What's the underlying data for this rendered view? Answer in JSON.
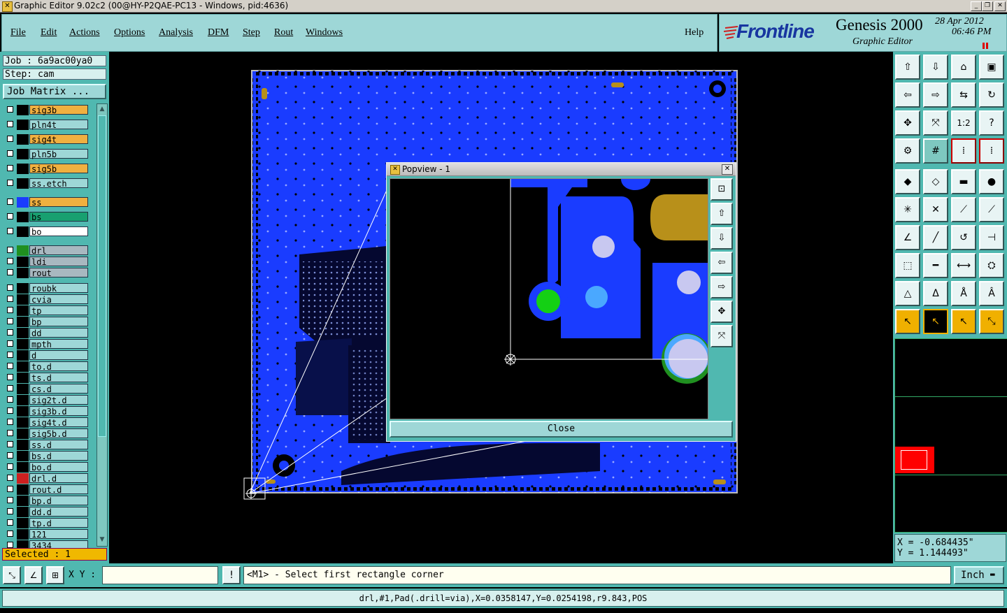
{
  "window": {
    "title": "Graphic Editor 9.02c2 (00@HY-P2QAE-PC13 - Windows, pid:4636)"
  },
  "menu": {
    "items": [
      "File",
      "Edit",
      "Actions",
      "Options",
      "Analysis",
      "DFM",
      "Step",
      "Rout",
      "Windows"
    ],
    "help": "Help"
  },
  "brand": {
    "logo": "Frontline",
    "product": "Genesis 2000",
    "subtitle": "Graphic Editor",
    "date": "28 Apr 2012",
    "time": "06:46 PM"
  },
  "job": {
    "job_label": "Job : 6a9ac00ya0",
    "step_label": "Step: cam",
    "matrix_button": "Job Matrix ..."
  },
  "layers": [
    {
      "name": "sig3b",
      "bg": "#f0b040",
      "color": "#000000"
    },
    {
      "name": "pln4t",
      "bg": "#9ed7d7",
      "color": "#000000"
    },
    {
      "name": "sig4t",
      "bg": "#f0b040",
      "color": "#000000"
    },
    {
      "name": "pln5b",
      "bg": "#9ed7d7",
      "color": "#000000"
    },
    {
      "name": "sig5b",
      "bg": "#f0b040",
      "color": "#000000"
    },
    {
      "name": "ss.etch",
      "bg": "#9ed7d7",
      "color": "#000000"
    },
    {
      "name": "ss",
      "bg": "#f0b040",
      "color": "#1a3cff"
    },
    {
      "name": "bs",
      "bg": "#18a070",
      "color": "#000000"
    },
    {
      "name": "bo",
      "bg": "#ffffff",
      "color": "#000000"
    },
    {
      "name": "drl",
      "bg": "#a8b8c0",
      "color": "#209020"
    },
    {
      "name": "ldi",
      "bg": "#a8b8c0",
      "color": "#000000"
    },
    {
      "name": "rout",
      "bg": "#a8b8c0",
      "color": "#000000"
    },
    {
      "name": "roubk",
      "bg": "#9ed7d7",
      "color": "#000000"
    },
    {
      "name": "cvia",
      "bg": "#9ed7d7",
      "color": "#000000"
    },
    {
      "name": "tp",
      "bg": "#9ed7d7",
      "color": "#000000"
    },
    {
      "name": "bp",
      "bg": "#9ed7d7",
      "color": "#000000"
    },
    {
      "name": "dd",
      "bg": "#9ed7d7",
      "color": "#000000"
    },
    {
      "name": "mpth",
      "bg": "#9ed7d7",
      "color": "#000000"
    },
    {
      "name": "d",
      "bg": "#9ed7d7",
      "color": "#000000"
    },
    {
      "name": "to.d",
      "bg": "#9ed7d7",
      "color": "#000000"
    },
    {
      "name": "ts.d",
      "bg": "#9ed7d7",
      "color": "#000000"
    },
    {
      "name": "cs.d",
      "bg": "#9ed7d7",
      "color": "#000000"
    },
    {
      "name": "sig2t.d",
      "bg": "#9ed7d7",
      "color": "#000000"
    },
    {
      "name": "sig3b.d",
      "bg": "#9ed7d7",
      "color": "#000000"
    },
    {
      "name": "sig4t.d",
      "bg": "#9ed7d7",
      "color": "#000000"
    },
    {
      "name": "sig5b.d",
      "bg": "#9ed7d7",
      "color": "#000000"
    },
    {
      "name": "ss.d",
      "bg": "#9ed7d7",
      "color": "#000000"
    },
    {
      "name": "bs.d",
      "bg": "#9ed7d7",
      "color": "#000000"
    },
    {
      "name": "bo.d",
      "bg": "#9ed7d7",
      "color": "#000000"
    },
    {
      "name": "drl.d",
      "bg": "#9ed7d7",
      "color": "#cc2020"
    },
    {
      "name": "rout.d",
      "bg": "#9ed7d7",
      "color": "#000000"
    },
    {
      "name": "bp.d",
      "bg": "#9ed7d7",
      "color": "#000000"
    },
    {
      "name": "dd.d",
      "bg": "#9ed7d7",
      "color": "#000000"
    },
    {
      "name": "tp.d",
      "bg": "#9ed7d7",
      "color": "#000000"
    },
    {
      "name": "121",
      "bg": "#9ed7d7",
      "color": "#000000"
    },
    {
      "name": "3434",
      "bg": "#9ed7d7",
      "color": "#000000"
    }
  ],
  "selected": "Selected : 1",
  "popview": {
    "title": "Popview - 1",
    "close_button": "Close"
  },
  "coords": {
    "x": "X = -0.684435\"",
    "y": "Y = 1.144493\""
  },
  "command": {
    "xy_label": "X Y :",
    "input_value": "",
    "prompt": "<M1> - Select first rectangle corner",
    "units": "Inch"
  },
  "status": "drl,#1,Pad(.drill=via),X=0.0358147,Y=0.0254198,r9.843,POS",
  "colors": {
    "panel": "#50b8b0",
    "menu": "#9ed7d7",
    "board": "#1a3cff",
    "copper": "#b8901a"
  }
}
